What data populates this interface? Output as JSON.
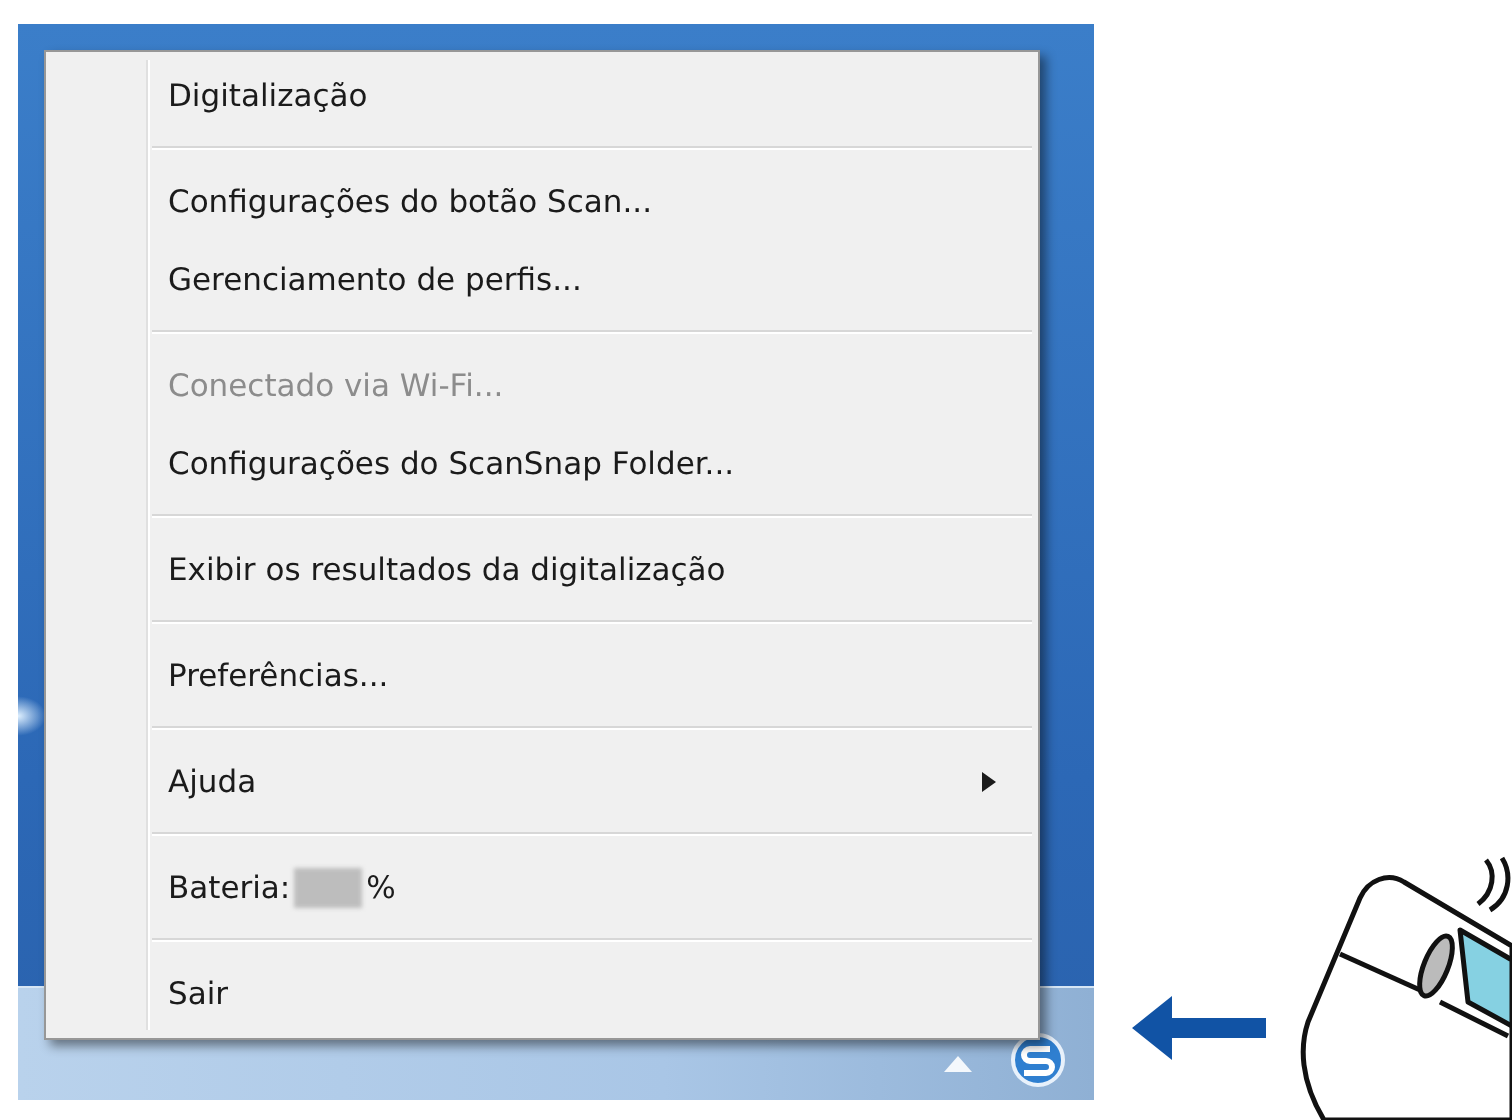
{
  "menu": {
    "groups": [
      {
        "items": [
          {
            "kind": "command",
            "label": "Digitalização",
            "disabled": false,
            "submenu": false
          }
        ]
      },
      {
        "items": [
          {
            "kind": "command",
            "label": "Configurações do botão Scan...",
            "disabled": false,
            "submenu": false
          },
          {
            "kind": "command",
            "label": "Gerenciamento de perfis...",
            "disabled": false,
            "submenu": false
          }
        ]
      },
      {
        "items": [
          {
            "kind": "command",
            "label": "Conectado via Wi-Fi...",
            "disabled": true,
            "submenu": false
          },
          {
            "kind": "command",
            "label": "Configurações do ScanSnap Folder...",
            "disabled": false,
            "submenu": false
          }
        ]
      },
      {
        "items": [
          {
            "kind": "command",
            "label": "Exibir os resultados da digitalização",
            "disabled": false,
            "submenu": false
          }
        ]
      },
      {
        "items": [
          {
            "kind": "command",
            "label": "Preferências...",
            "disabled": false,
            "submenu": false
          }
        ]
      },
      {
        "items": [
          {
            "kind": "command",
            "label": "Ajuda",
            "disabled": false,
            "submenu": true
          }
        ]
      },
      {
        "items": [
          {
            "kind": "battery",
            "label": "Bateria:",
            "suffix": "%",
            "disabled": false,
            "submenu": false
          }
        ]
      },
      {
        "items": [
          {
            "kind": "command",
            "label": "Sair",
            "disabled": false,
            "submenu": false
          }
        ]
      }
    ]
  }
}
